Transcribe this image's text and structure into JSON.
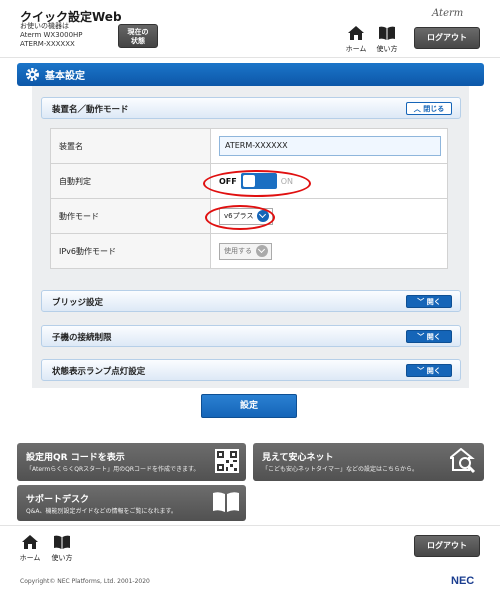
{
  "header": {
    "title": "クイック設定Web",
    "device_label": "お使いの機器は",
    "model": "Aterm WX3000HP",
    "device_id": "ATERM-XXXXXX",
    "status_button": [
      "現在の",
      "状態"
    ],
    "brand": "Aterm",
    "nav_home": "ホーム",
    "nav_guide": "使い方",
    "logout": "ログアウト"
  },
  "section": {
    "title": "基本設定"
  },
  "accordions": {
    "device": {
      "title": "装置名／動作モード",
      "button": "閉じる"
    },
    "bridge": {
      "title": "ブリッジ設定",
      "button": "開く"
    },
    "child": {
      "title": "子機の接続制限",
      "button": "開く"
    },
    "lamp": {
      "title": "状態表示ランプ点灯設定",
      "button": "開く"
    }
  },
  "rows": {
    "device_name": {
      "label": "装置名",
      "value": "ATERM-XXXXXX"
    },
    "auto_detect": {
      "label": "自動判定",
      "off": "OFF",
      "on": "ON",
      "state": "OFF"
    },
    "mode": {
      "label": "動作モード",
      "value": "v6プラス"
    },
    "ipv6_mode": {
      "label": "IPv6動作モード",
      "value": "使用する"
    }
  },
  "submit": "設定",
  "tiles": {
    "qr": {
      "title": "設定用QR コードを表示",
      "desc": "「AtermらくらくQRスタート」用のQRコードを作成できます。"
    },
    "safety": {
      "title": "見えて安心ネット",
      "desc": "「こども安心ネットタイマー」などの設定はこちらから。"
    },
    "support": {
      "title": "サポートデスク",
      "desc": "Q&A、機能別設定ガイドなどの情報をご覧になれます。"
    }
  },
  "footer": {
    "nav_home": "ホーム",
    "nav_guide": "使い方",
    "logout": "ログアウト",
    "copyright": "Copyright© NEC Platforms, Ltd. 2001-2020",
    "nec": "NEC"
  },
  "colors": {
    "accent": "#1565b8",
    "highlight_ring": "#e01010",
    "tile": "#5e5e5e"
  }
}
